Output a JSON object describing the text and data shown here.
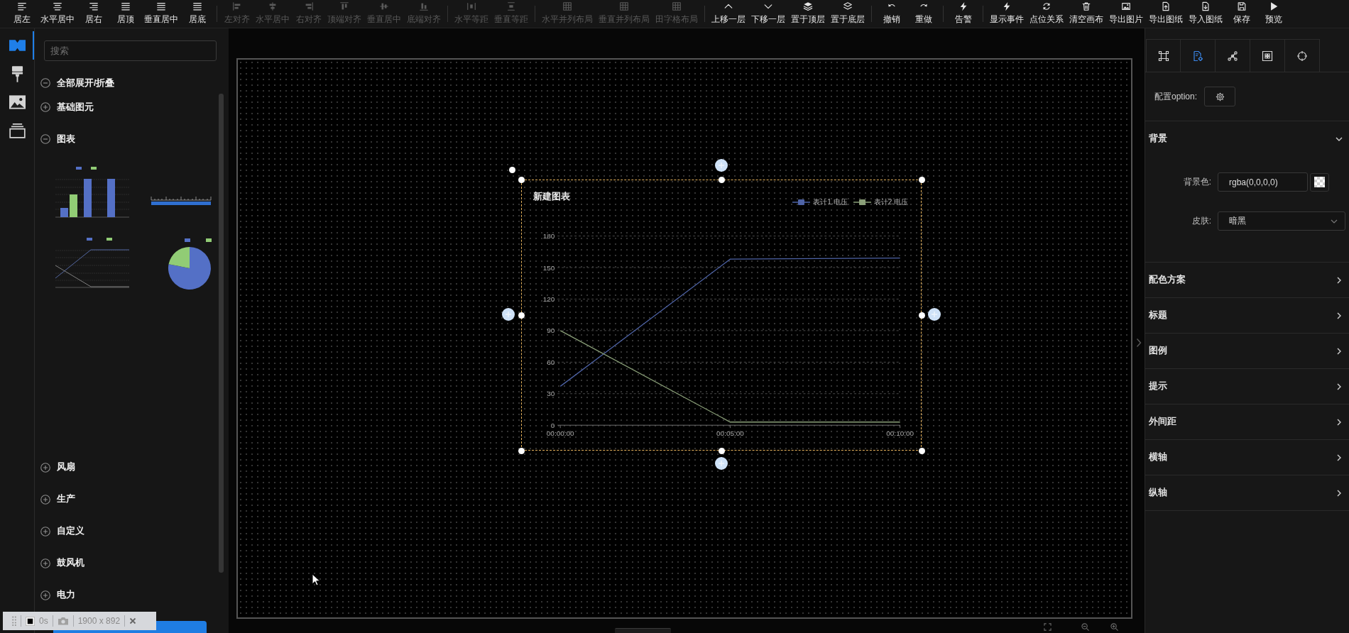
{
  "toolbar": {
    "groups": [
      [
        {
          "label": "居左",
          "disabled": false
        },
        {
          "label": "水平居中",
          "disabled": false
        },
        {
          "label": "居右",
          "disabled": false
        },
        {
          "label": "居顶",
          "disabled": false
        },
        {
          "label": "垂直居中",
          "disabled": false
        },
        {
          "label": "居底",
          "disabled": false
        }
      ],
      [
        {
          "label": "左对齐",
          "disabled": true
        },
        {
          "label": "水平居中",
          "disabled": true
        },
        {
          "label": "右对齐",
          "disabled": true
        },
        {
          "label": "顶端对齐",
          "disabled": true
        },
        {
          "label": "垂直居中",
          "disabled": true
        },
        {
          "label": "底端对齐",
          "disabled": true
        }
      ],
      [
        {
          "label": "水平等距",
          "disabled": true
        },
        {
          "label": "垂直等距",
          "disabled": true
        }
      ],
      [
        {
          "label": "水平并列布局",
          "disabled": true
        },
        {
          "label": "垂直并列布局",
          "disabled": true
        },
        {
          "label": "田字格布局",
          "disabled": true
        }
      ],
      [
        {
          "label": "上移一层",
          "disabled": false
        },
        {
          "label": "下移一层",
          "disabled": false
        },
        {
          "label": "置于顶层",
          "disabled": false
        },
        {
          "label": "置于底层",
          "disabled": false
        }
      ],
      [
        {
          "label": "撤销",
          "disabled": false
        },
        {
          "label": "重做",
          "disabled": false
        }
      ],
      [
        {
          "label": "告警",
          "disabled": false
        }
      ],
      [
        {
          "label": "显示事件",
          "disabled": false
        },
        {
          "label": "点位关系",
          "disabled": false
        },
        {
          "label": "清空画布",
          "disabled": false
        },
        {
          "label": "导出图片",
          "disabled": false
        },
        {
          "label": "导出图纸",
          "disabled": false
        },
        {
          "label": "导入图纸",
          "disabled": false
        },
        {
          "label": "保存",
          "disabled": false
        },
        {
          "label": "预览",
          "disabled": false
        }
      ]
    ]
  },
  "rail": [
    {
      "selected": true
    },
    {
      "selected": false
    },
    {
      "selected": false
    },
    {
      "selected": false
    }
  ],
  "library": {
    "search": {
      "placeholder": "搜索"
    },
    "groups": [
      {
        "label": "全部展开/折叠",
        "expanded": true
      },
      {
        "label": "基础图元",
        "expanded": false
      },
      {
        "label": "图表",
        "expanded": true,
        "thumbnails": [
          {
            "kind": "bar"
          },
          {
            "kind": "gauge"
          },
          {
            "kind": "line"
          },
          {
            "kind": "pie"
          }
        ]
      },
      {
        "label": "风扇",
        "expanded": false
      },
      {
        "label": "生产",
        "expanded": false
      },
      {
        "label": "自定义",
        "expanded": false
      },
      {
        "label": "鼓风机",
        "expanded": false
      },
      {
        "label": "电力",
        "expanded": false
      }
    ]
  },
  "canvas": {
    "widget": {
      "selected": true,
      "chart_data": {
        "type": "line",
        "title": "新建图表",
        "categories": [
          "00:00:00",
          "00:05:00",
          "00:10:00"
        ],
        "series": [
          {
            "name": "表计1.电压",
            "color": "#4e63a6",
            "values": [
              37,
              158,
              159
            ]
          },
          {
            "name": "表计2.电压",
            "color": "#8a9f78",
            "values": [
              90,
              3,
              3
            ]
          }
        ],
        "ylim": [
          0,
          180
        ],
        "yticks": [
          0,
          30,
          60,
          90,
          120,
          150,
          180
        ],
        "grid": true,
        "legend": true
      }
    }
  },
  "inspector": {
    "tabs": [
      {
        "selected": false
      },
      {
        "selected": true
      },
      {
        "selected": false
      },
      {
        "selected": false
      },
      {
        "selected": false
      }
    ],
    "option_label": "配置option:",
    "sections": [
      {
        "title": "背景",
        "expanded": true,
        "fields": [
          {
            "kind": "color",
            "label": "背景色:",
            "value": "rgba(0,0,0,0)"
          },
          {
            "kind": "select",
            "label": "皮肤:",
            "value": "暗黑"
          }
        ]
      },
      {
        "title": "配色方案",
        "expanded": false
      },
      {
        "title": "标题",
        "expanded": false
      },
      {
        "title": "图例",
        "expanded": false
      },
      {
        "title": "提示",
        "expanded": false
      },
      {
        "title": "外间距",
        "expanded": false
      },
      {
        "title": "横轴",
        "expanded": false
      },
      {
        "title": "纵轴",
        "expanded": false
      }
    ]
  },
  "recorder": {
    "elapsed": "0s",
    "size": "1900 x 892"
  }
}
